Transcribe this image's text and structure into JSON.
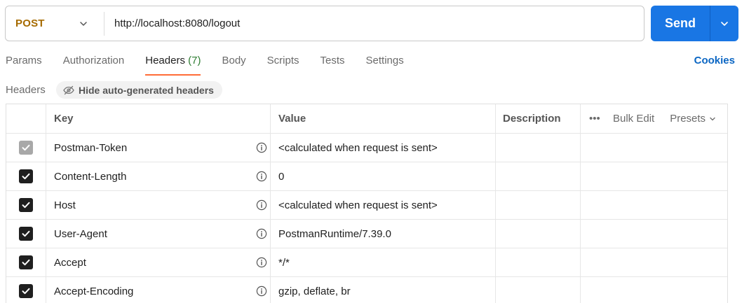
{
  "request": {
    "method": "POST",
    "url": "http://localhost:8080/logout",
    "send_label": "Send"
  },
  "tabs": [
    {
      "label": "Params"
    },
    {
      "label": "Authorization"
    },
    {
      "label": "Headers",
      "count": "(7)",
      "active": true
    },
    {
      "label": "Body"
    },
    {
      "label": "Scripts"
    },
    {
      "label": "Tests"
    },
    {
      "label": "Settings"
    }
  ],
  "cookies_label": "Cookies",
  "headers_section": {
    "title": "Headers",
    "hide_auto_label": "Hide auto-generated headers"
  },
  "table": {
    "columns": {
      "key": "Key",
      "value": "Value",
      "description": "Description",
      "more": "•••",
      "bulk_edit": "Bulk Edit",
      "presets": "Presets"
    },
    "rows": [
      {
        "checked": true,
        "disabled": true,
        "key": "Postman-Token",
        "value": "<calculated when request is sent>"
      },
      {
        "checked": true,
        "disabled": false,
        "key": "Content-Length",
        "value": "0"
      },
      {
        "checked": true,
        "disabled": false,
        "key": "Host",
        "value": "<calculated when request is sent>"
      },
      {
        "checked": true,
        "disabled": false,
        "key": "User-Agent",
        "value": "PostmanRuntime/7.39.0"
      },
      {
        "checked": true,
        "disabled": false,
        "key": "Accept",
        "value": "*/*"
      },
      {
        "checked": true,
        "disabled": false,
        "key": "Accept-Encoding",
        "value": "gzip, deflate, br"
      }
    ]
  },
  "colors": {
    "method": "#a66b00",
    "send_button": "#1976e4",
    "active_tab_underline": "#ff6c37",
    "tab_count": "#2e7d32",
    "cookies_link": "#0b66c3"
  },
  "icons": {
    "method_dropdown": "chevron-down-icon",
    "send_dropdown": "chevron-down-icon",
    "hide_auto": "eye-off-icon",
    "info": "info-icon",
    "checkbox": "check-icon"
  }
}
